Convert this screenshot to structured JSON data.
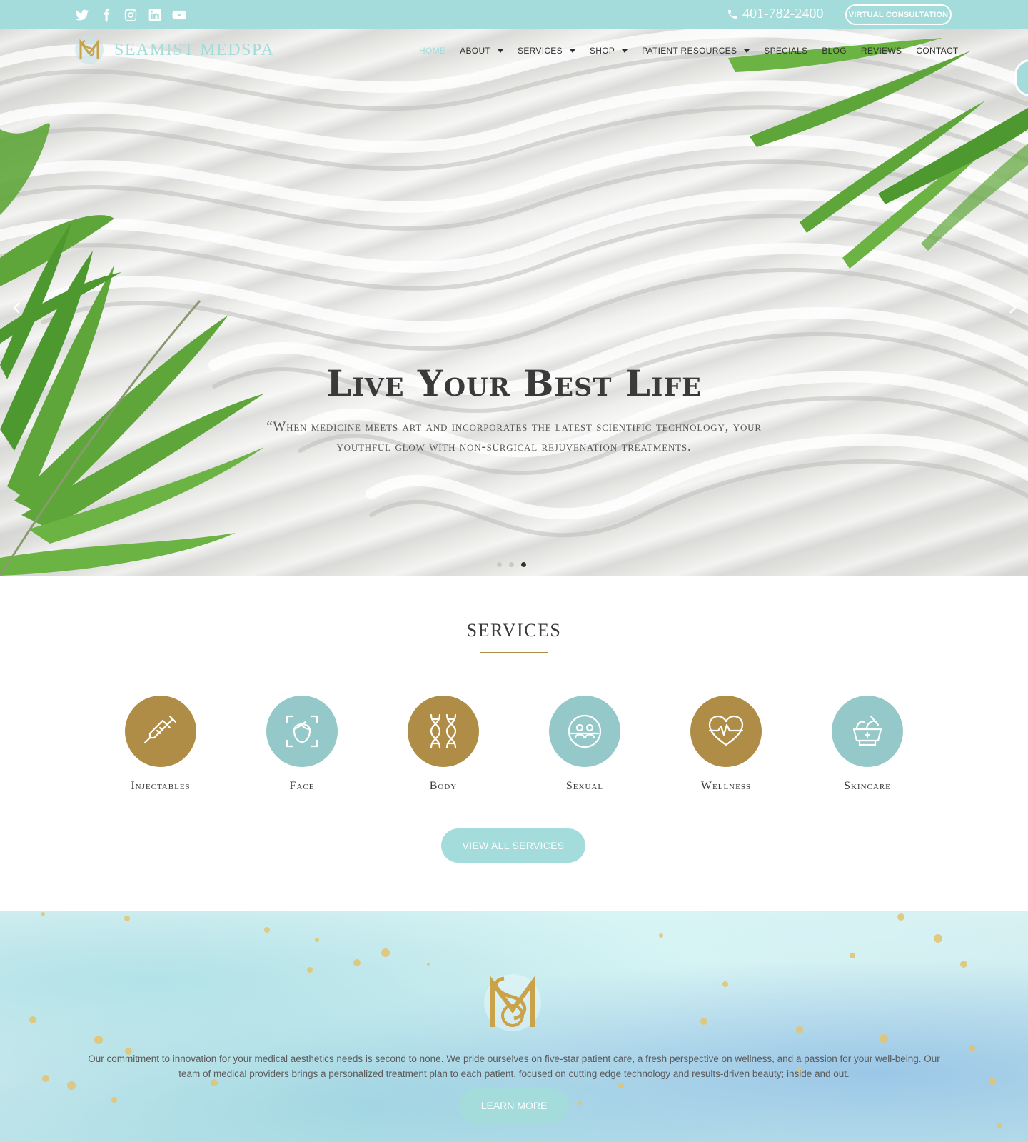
{
  "colors": {
    "teal": "#a3dcdb",
    "teal_dark": "#94c8c9",
    "gold": "#b08d46",
    "text": "#3a3a3a"
  },
  "topbar": {
    "social_icons": [
      "twitter-icon",
      "facebook-icon",
      "instagram-icon",
      "linkedin-icon",
      "youtube-icon"
    ],
    "phone": "401-782-2400",
    "consult_label": "VIRTUAL CONSULTATION"
  },
  "nav": {
    "brand": "SEAMIST MEDSPA",
    "items": [
      {
        "label": "HOME",
        "dropdown": false,
        "active": true
      },
      {
        "label": "ABOUT",
        "dropdown": true
      },
      {
        "label": "SERVICES",
        "dropdown": true
      },
      {
        "label": "SHOP",
        "dropdown": true
      },
      {
        "label": "PATIENT RESOURCES",
        "dropdown": true
      },
      {
        "label": "SPECIALS",
        "dropdown": false
      },
      {
        "label": "BLOG",
        "dropdown": false
      },
      {
        "label": "REVIEWS",
        "dropdown": false
      },
      {
        "label": "CONTACT",
        "dropdown": false
      }
    ]
  },
  "hero": {
    "title": "Live Your Best Life",
    "quote": "“When medicine meets art and incorporates the latest scientific technology, your youthful glow with non-surgical rejuvenation treatments.",
    "slides_total": 3,
    "slide_active": 3
  },
  "services": {
    "title": "SERVICES",
    "items": [
      {
        "label": "Injectables",
        "icon": "syringe-icon",
        "color": "#b08d46"
      },
      {
        "label": "Face",
        "icon": "face-icon",
        "color": "#94c8c9"
      },
      {
        "label": "Body",
        "icon": "dna-icon",
        "color": "#b08d46"
      },
      {
        "label": "Sexual",
        "icon": "couple-icon",
        "color": "#94c8c9"
      },
      {
        "label": "Wellness",
        "icon": "heartbeat-icon",
        "color": "#b08d46"
      },
      {
        "label": "Skincare",
        "icon": "mortar-icon",
        "color": "#94c8c9"
      }
    ],
    "view_all_label": "VIEW ALL SERVICES"
  },
  "about": {
    "text": "Our commitment to innovation for your medical aesthetics needs is second to none. We pride ourselves on five-star patient care, a fresh perspective on wellness, and a passion for your well-being. Our team of medical providers brings a personalized treatment plan to each patient, focused on cutting edge technology and results-driven beauty; inside and out.",
    "cta_label": "LEARN MORE"
  }
}
